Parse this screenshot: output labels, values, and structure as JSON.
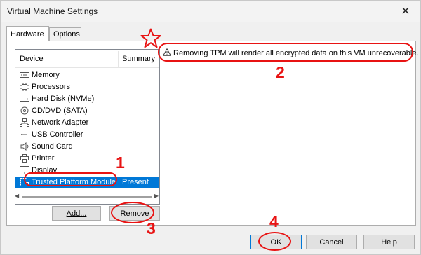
{
  "window": {
    "title": "Virtual Machine Settings",
    "close_glyph": "✕"
  },
  "tabs": [
    {
      "label": "Hardware",
      "active": true
    },
    {
      "label": "Options",
      "active": false
    }
  ],
  "device_list": {
    "columns": [
      "Device",
      "Summary"
    ],
    "rows": [
      {
        "icon": "memory-icon",
        "label": "Memory",
        "summary": ""
      },
      {
        "icon": "processor-icon",
        "label": "Processors",
        "summary": ""
      },
      {
        "icon": "hard-disk-icon",
        "label": "Hard Disk (NVMe)",
        "summary": ""
      },
      {
        "icon": "cd-dvd-icon",
        "label": "CD/DVD (SATA)",
        "summary": ""
      },
      {
        "icon": "network-adapter-icon",
        "label": "Network Adapter",
        "summary": ""
      },
      {
        "icon": "usb-icon",
        "label": "USB Controller",
        "summary": ""
      },
      {
        "icon": "sound-card-icon",
        "label": "Sound Card",
        "summary": ""
      },
      {
        "icon": "printer-icon",
        "label": "Printer",
        "summary": ""
      },
      {
        "icon": "display-icon",
        "label": "Display",
        "summary": ""
      },
      {
        "icon": "tpm-icon",
        "label": "Trusted Platform Module",
        "summary": "Present",
        "selected": true
      }
    ]
  },
  "buttons": {
    "add": "Add...",
    "remove": "Remove",
    "ok": "OK",
    "cancel": "Cancel",
    "help": "Help"
  },
  "warning": {
    "icon": "warning-icon",
    "text": "Removing TPM will render all encrypted data on this VM unrecoverable."
  },
  "annotations": {
    "color": "#e81313",
    "labels": [
      "1",
      "2",
      "3",
      "4"
    ]
  },
  "colors": {
    "selection": "#0078d7",
    "accent_border": "#0078d7"
  }
}
